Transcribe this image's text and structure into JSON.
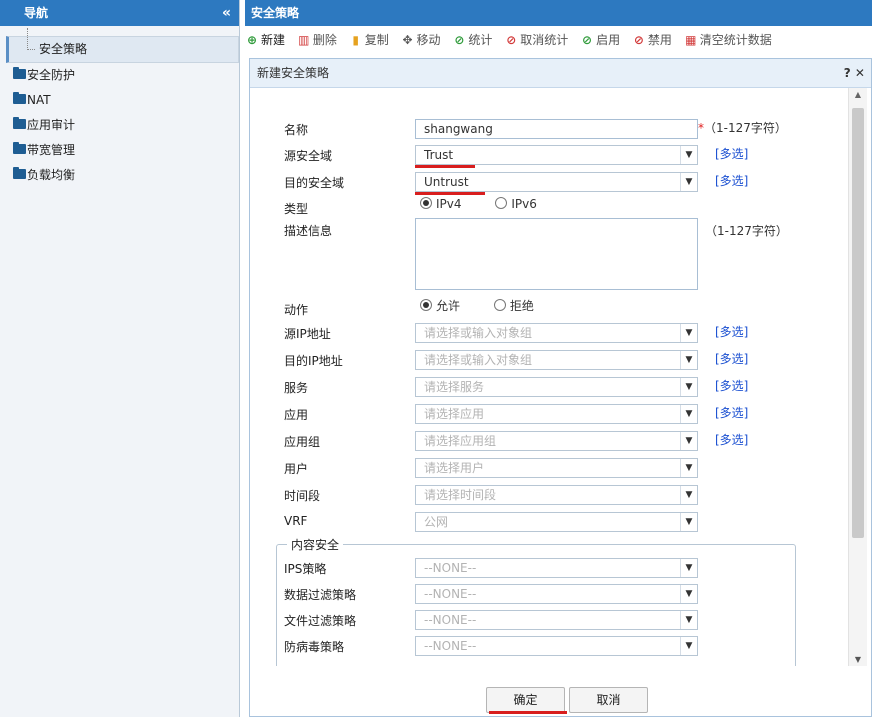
{
  "nav": {
    "title": "导航",
    "collapse_glyph": "«",
    "items": [
      {
        "label": "安全策略",
        "type": "child",
        "icon": "tree-branch"
      },
      {
        "label": "安全防护",
        "type": "folder",
        "icon": "folder-icon"
      },
      {
        "label": "NAT",
        "type": "folder",
        "icon": "folder-icon"
      },
      {
        "label": "应用审计",
        "type": "folder",
        "icon": "folder-icon"
      },
      {
        "label": "带宽管理",
        "type": "folder",
        "icon": "folder-icon"
      },
      {
        "label": "负载均衡",
        "type": "folder",
        "icon": "folder-icon"
      }
    ]
  },
  "main": {
    "title": "安全策略",
    "toolbar": [
      {
        "label": "新建",
        "icon": "add-icon",
        "glyph": "⊕"
      },
      {
        "label": "删除",
        "icon": "trash-icon",
        "glyph": "▥"
      },
      {
        "label": "复制",
        "icon": "copy-icon",
        "glyph": "▮"
      },
      {
        "label": "移动",
        "icon": "move-icon",
        "glyph": "✥"
      },
      {
        "label": "统计",
        "icon": "check-circle-icon",
        "glyph": "⊘"
      },
      {
        "label": "取消统计",
        "icon": "cancel-icon",
        "glyph": "⊘"
      },
      {
        "label": "启用",
        "icon": "check-circle-icon",
        "glyph": "⊘"
      },
      {
        "label": "禁用",
        "icon": "ban-icon",
        "glyph": "⊘"
      },
      {
        "label": "清空统计数据",
        "icon": "clear-stats-icon",
        "glyph": "▦"
      }
    ]
  },
  "dialog": {
    "title": "新建安全策略",
    "help_glyph": "? ✕",
    "fields": {
      "name": {
        "label": "名称",
        "value": "shangwang",
        "required_mark": "*",
        "hint": "（1-127字符）"
      },
      "src_zone": {
        "label": "源安全域",
        "value": "Trust",
        "multi": "[多选]"
      },
      "dst_zone": {
        "label": "目的安全域",
        "value": "Untrust",
        "multi": "[多选]"
      },
      "type": {
        "label": "类型",
        "options": [
          "IPv4",
          "IPv6"
        ],
        "selected": "IPv4"
      },
      "description": {
        "label": "描述信息",
        "value": "",
        "hint": "（1-127字符）"
      },
      "action": {
        "label": "动作",
        "options": [
          "允许",
          "拒绝"
        ],
        "selected": "允许"
      },
      "src_ip": {
        "label": "源IP地址",
        "placeholder": "请选择或输入对象组",
        "multi": "[多选]"
      },
      "dst_ip": {
        "label": "目的IP地址",
        "placeholder": "请选择或输入对象组",
        "multi": "[多选]"
      },
      "service": {
        "label": "服务",
        "placeholder": "请选择服务",
        "multi": "[多选]"
      },
      "application": {
        "label": "应用",
        "placeholder": "请选择应用",
        "multi": "[多选]"
      },
      "app_group": {
        "label": "应用组",
        "placeholder": "请选择应用组",
        "multi": "[多选]"
      },
      "user": {
        "label": "用户",
        "placeholder": "请选择用户"
      },
      "time_range": {
        "label": "时间段",
        "placeholder": "请选择时间段"
      },
      "vrf": {
        "label": "VRF",
        "value": "公网"
      }
    },
    "content_security": {
      "legend": "内容安全",
      "fields": [
        {
          "label": "IPS策略",
          "value": "--NONE--"
        },
        {
          "label": "数据过滤策略",
          "value": "--NONE--"
        },
        {
          "label": "文件过滤策略",
          "value": "--NONE--"
        },
        {
          "label": "防病毒策略",
          "value": "--NONE--"
        }
      ]
    },
    "buttons": {
      "ok": "确定",
      "cancel": "取消"
    }
  },
  "colors": {
    "header_blue": "#2d79c0",
    "link_blue": "#1a4fd1",
    "accent_red": "#d81e1e"
  }
}
